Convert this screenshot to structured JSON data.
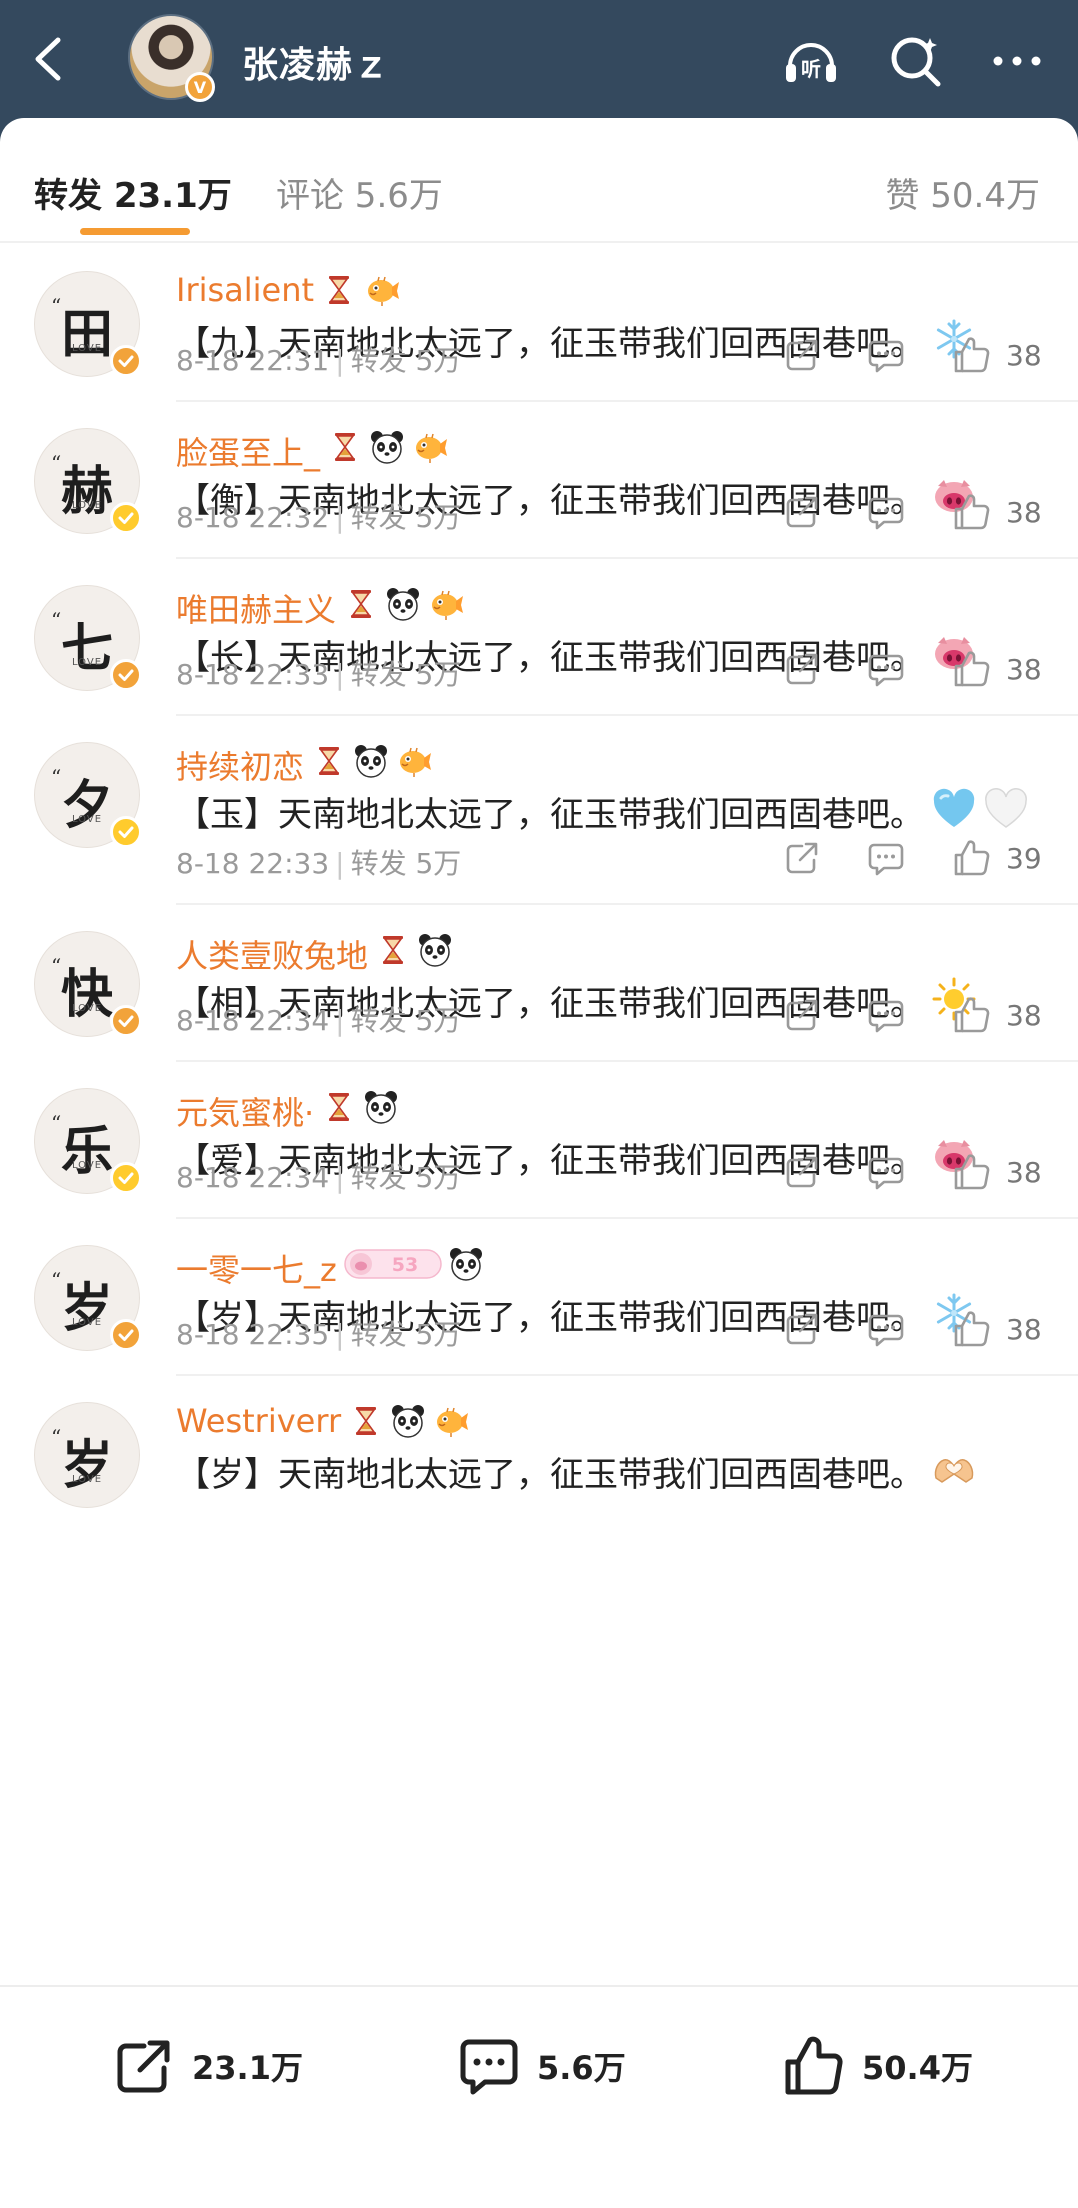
{
  "header": {
    "user_name": "张凌赫ｚ",
    "icons": [
      "back-icon",
      "listen-icon",
      "search-icon",
      "more-icon"
    ],
    "listen_label": "听"
  },
  "tabs": {
    "reposts": "转发 23.1万",
    "comments": "评论 5.6万",
    "likes": "赞 50.4万"
  },
  "accent_color": "#f59b32",
  "reposts": [
    {
      "avatar_glyph": "田",
      "verify": "orange",
      "name": "Irisalient",
      "badges": [
        "hourglass",
        "pufferfish"
      ],
      "text": "【九】天南地北太远了，征玉带我们回西固巷吧。",
      "emoji": "snowflake",
      "time": "8-18 22:31",
      "repost": "转发 5万",
      "likes": "38"
    },
    {
      "avatar_glyph": "赫",
      "verify": "yellow",
      "name": "脸蛋至上_",
      "badges": [
        "hourglass",
        "panda",
        "pufferfish"
      ],
      "text": "【衡】天南地北太远了，征玉带我们回西固巷吧。",
      "emoji": "pig",
      "time": "8-18 22:32",
      "repost": "转发 5万",
      "likes": "38"
    },
    {
      "avatar_glyph": "七",
      "verify": "orange",
      "name": "唯田赫主义",
      "badges": [
        "hourglass",
        "panda",
        "pufferfish"
      ],
      "text": "【长】天南地北太远了，征玉带我们回西固巷吧。",
      "emoji": "pig",
      "time": "8-18 22:33",
      "repost": "转发 5万",
      "likes": "38"
    },
    {
      "avatar_glyph": "夕",
      "verify": "yellow",
      "name": "持续初恋",
      "badges": [
        "hourglass",
        "panda",
        "pufferfish"
      ],
      "text": "【玉】天南地北太远了，征玉带我们回西固巷吧。",
      "emoji": "blue-heart",
      "emoji2": "white-heart",
      "time": "8-18 22:33",
      "repost": "转发 5万",
      "likes": "39"
    },
    {
      "avatar_glyph": "快",
      "verify": "orange",
      "name": "人类壹败兔地",
      "badges": [
        "hourglass",
        "panda"
      ],
      "text": "【相】天南地北太远了，征玉带我们回西固巷吧。",
      "emoji": "sun",
      "time": "8-18 22:34",
      "repost": "转发 5万",
      "likes": "38"
    },
    {
      "avatar_glyph": "乐",
      "verify": "yellow",
      "name": "元気蜜桃·",
      "badges": [
        "hourglass",
        "panda"
      ],
      "text": "【爱】天南地北太远了，征玉带我们回西固巷吧。",
      "emoji": "pig",
      "time": "8-18 22:34",
      "repost": "转发 5万",
      "likes": "38"
    },
    {
      "avatar_glyph": "岁",
      "verify": "orange",
      "name": "一零一七_z",
      "badges": [
        "level-53",
        "panda"
      ],
      "level": "53",
      "text": "【岁】天南地北太远了，征玉带我们回西固巷吧。",
      "emoji": "snowflake",
      "time": "8-18 22:35",
      "repost": "转发 5万",
      "likes": "38"
    },
    {
      "avatar_glyph": "岁",
      "verify": "none",
      "name": "Westriverr",
      "badges": [
        "hourglass",
        "panda",
        "pufferfish"
      ],
      "text": "【岁】天南地北太远了，征玉带我们回西固巷吧。",
      "emoji": "heart-hands"
    }
  ],
  "avatar_caption": "LOVE",
  "avatar_quote": "“",
  "bottom_bar": {
    "reposts": "23.1万",
    "comments": "5.6万",
    "likes": "50.4万"
  }
}
